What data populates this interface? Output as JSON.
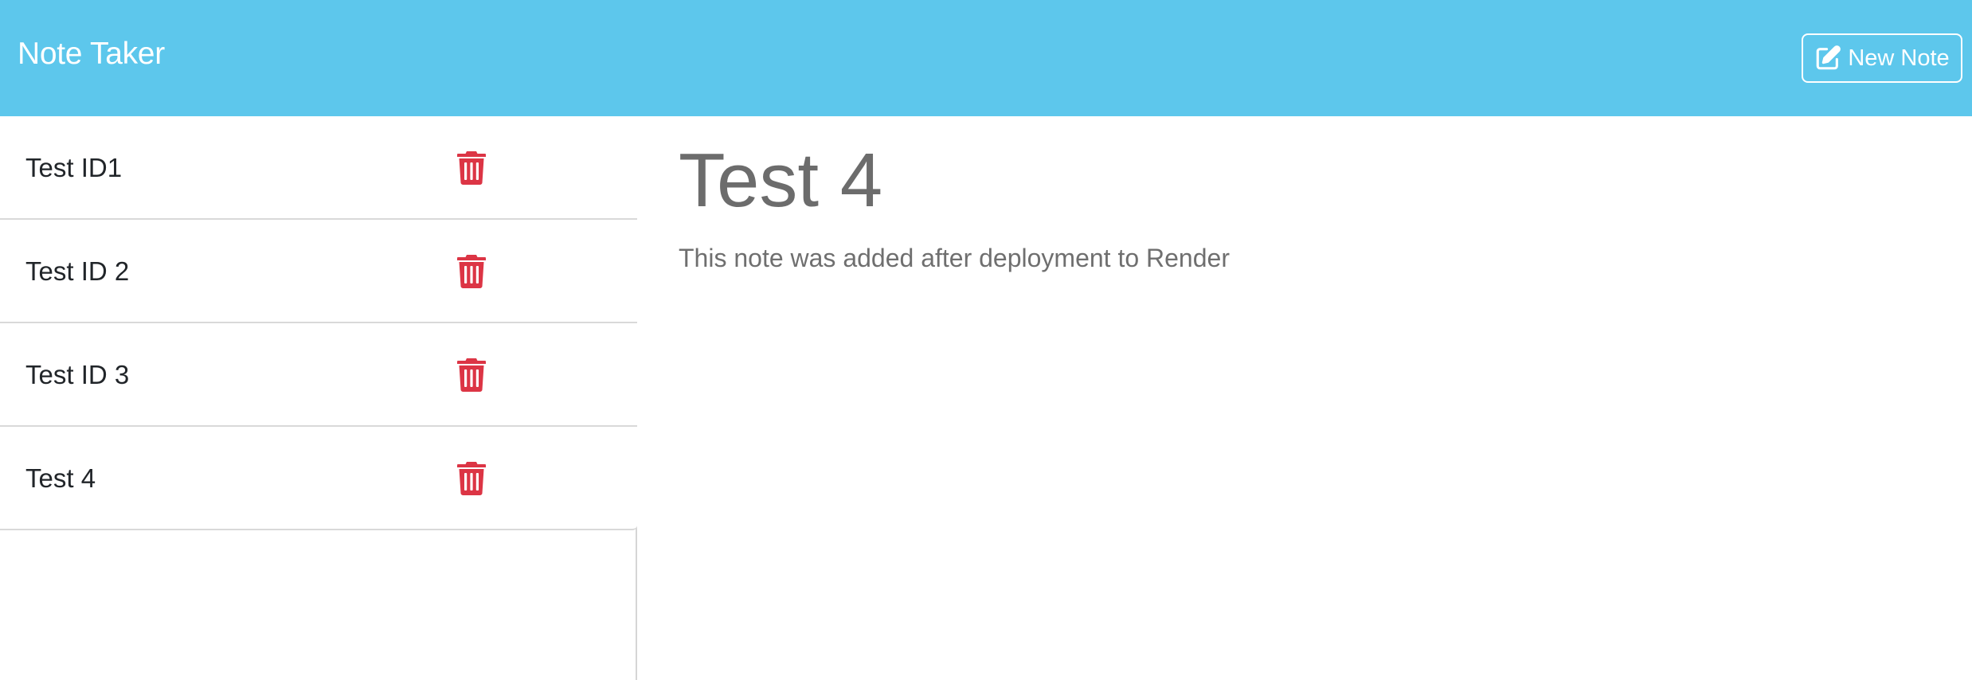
{
  "app": {
    "title": "Note Taker",
    "new_note_label": "New Note",
    "colors": {
      "navbar": "#5dc7ec",
      "delete": "#dc3545",
      "text_muted": "#6c6c6c"
    }
  },
  "sidebar": {
    "notes": [
      {
        "title": "Test ID1",
        "delete_icon": "trash-icon"
      },
      {
        "title": "Test ID 2",
        "delete_icon": "trash-icon"
      },
      {
        "title": "Test ID 3",
        "delete_icon": "trash-icon"
      },
      {
        "title": "Test 4",
        "delete_icon": "trash-icon"
      }
    ]
  },
  "main": {
    "active_note": {
      "title": "Test 4",
      "text": "This note was added after deployment to Render"
    }
  }
}
